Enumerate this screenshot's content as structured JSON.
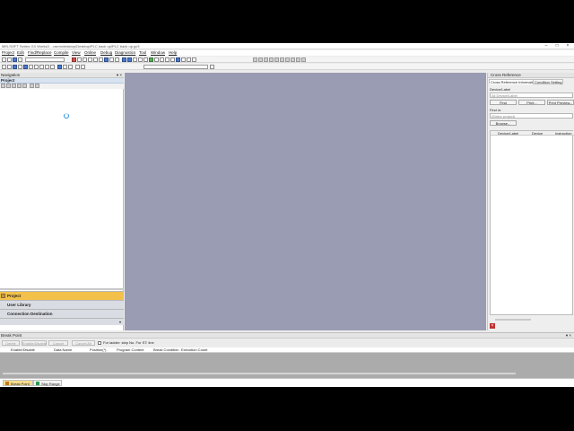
{
  "window": {
    "title": "MELSOFT Series GX Works3 ...users\\desktop\\Desktop\\PLC back up\\PLC back up.gx3",
    "minimize_icon": "minimize-icon",
    "maximize_icon": "maximize-icon",
    "close_icon": "close-icon"
  },
  "menu": [
    "Project",
    "Edit",
    "Find/Replace",
    "Compile",
    "View",
    "Online",
    "Debug",
    "Diagnostics",
    "Tool",
    "Window",
    "Help"
  ],
  "navigation": {
    "title": "Navigation",
    "controls": "▾ ×",
    "project_header": "Project",
    "tabs": {
      "project": "Project",
      "user_library": "User Library",
      "connection_destination": "Connection Destination"
    }
  },
  "cross_reference": {
    "title": "Cross Reference",
    "tabs": [
      "Cross Reference Information",
      "Condition Setting"
    ],
    "device_label_caption": "Device/Label",
    "device_label_placeholder": "All Device/Label",
    "find_button": "Find",
    "print_button": "Print...",
    "print_preview_button": "Print Preview...",
    "find_in_caption": "Find in:",
    "find_in_value": "(Entire project)",
    "browse_button": "Browse...",
    "columns": [
      "Device/Label",
      "Device",
      "Instruction"
    ]
  },
  "break_point": {
    "title": "Break Point",
    "controls": "▾ ×",
    "buttons": [
      "Delete",
      "Enable/Disable",
      "Cancel",
      "Cancel All"
    ],
    "option_label": "For ladder: step No.  For ST: line",
    "columns": [
      "Enable/Disable",
      "Data Name",
      "Position(*)",
      "Program Content",
      "Break Condition",
      "Execution Count"
    ]
  },
  "bottom_tabs": [
    "Break Point",
    "Skip Range"
  ],
  "colors": {
    "workspace": "#9A9CB4",
    "active_nav_tab": "#F3C14A",
    "loading_spinner": "#2C8FE0"
  }
}
